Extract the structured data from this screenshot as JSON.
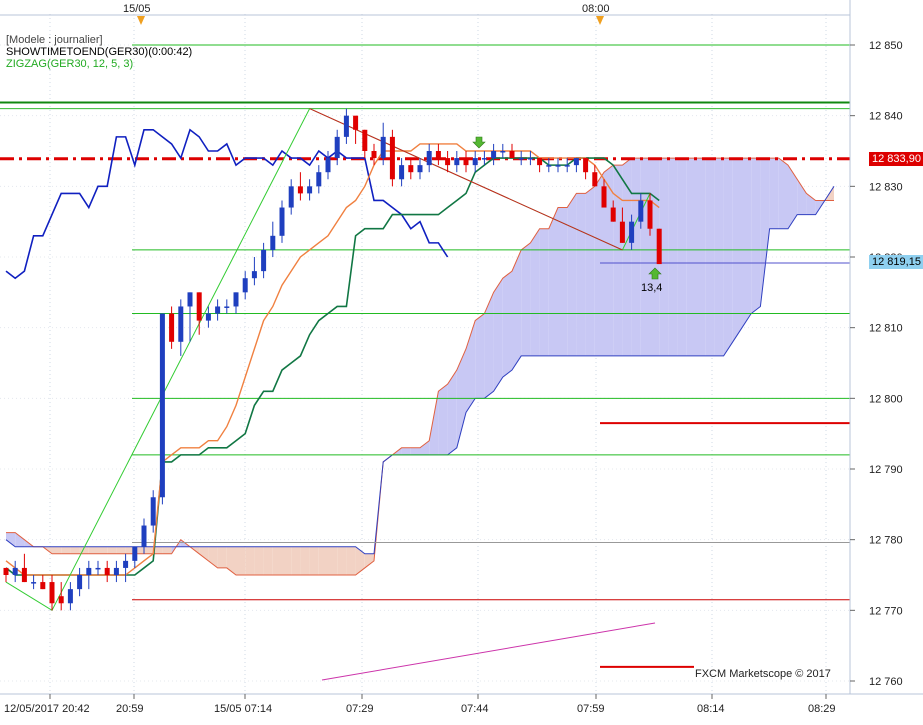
{
  "header": {
    "model_label": "[Modele : journalier]",
    "indicator_1": "SHOWTIMETOEND(GER30)(0:00:42)",
    "indicator_2": "ZIGZAG(GER30, 12, 5, 3)",
    "date_marker_1": "15/05",
    "date_marker_2": "08:00"
  },
  "price_tags": {
    "current": "12 833,90",
    "last": "12 819,15"
  },
  "annotation": "13,4",
  "watermark": "FXCM Marketscope © 2017",
  "colors": {
    "bull": "#1f3fbf",
    "bear": "#e00000",
    "kumo_bull": "#c8c8f4",
    "kumo_bear": "#f2d2c4",
    "grid_green": "#22bb22",
    "dash_red": "#dd0000"
  },
  "chart_data": {
    "type": "candlestick",
    "symbol": "GER30",
    "y_ticks": [
      12850,
      12840,
      12830,
      12820,
      12810,
      12800,
      12790,
      12780,
      12770,
      12760
    ],
    "y_tick_labels": [
      "12 850",
      "12 840",
      "12 830",
      "12 820",
      "12 810",
      "12 800",
      "12 790",
      "12 780",
      "12 770",
      "12 760"
    ],
    "x_tick_labels": [
      "12/05/2017 20:42",
      "20:59",
      "15/05 07:14",
      "07:29",
      "07:44",
      "07:59",
      "08:14",
      "08:29"
    ],
    "ylim": [
      12760,
      12853
    ],
    "candles": [
      [
        12776,
        12776,
        12774,
        12775
      ],
      [
        12775,
        12777,
        12774,
        12776
      ],
      [
        12776,
        12778,
        12774,
        12774
      ],
      [
        12774,
        12775,
        12773,
        12774
      ],
      [
        12774,
        12775,
        12773,
        12773
      ],
      [
        12774,
        12775,
        12770,
        12771
      ],
      [
        12772,
        12774,
        12770,
        12771
      ],
      [
        12771,
        12774,
        12770,
        12773
      ],
      [
        12773,
        12776,
        12772,
        12775
      ],
      [
        12775,
        12777,
        12773,
        12776
      ],
      [
        12776,
        12777,
        12775,
        12776
      ],
      [
        12776,
        12777,
        12774,
        12775
      ],
      [
        12775,
        12777,
        12774,
        12776
      ],
      [
        12776,
        12778,
        12774,
        12777
      ],
      [
        12777,
        12779,
        12776,
        12779
      ],
      [
        12779,
        12783,
        12778,
        12782
      ],
      [
        12782,
        12787,
        12781,
        12786
      ],
      [
        12786,
        12812,
        12785,
        12812
      ],
      [
        12812,
        12813,
        12807,
        12808
      ],
      [
        12808,
        12814,
        12806,
        12813
      ],
      [
        12813,
        12815,
        12808,
        12815
      ],
      [
        12815,
        12815,
        12809,
        12811
      ],
      [
        12811,
        12813,
        12810,
        12812
      ],
      [
        12812,
        12814,
        12811,
        12813
      ],
      [
        12813,
        12814,
        12812,
        12813
      ],
      [
        12813,
        12815,
        12812,
        12815
      ],
      [
        12815,
        12818,
        12814,
        12817
      ],
      [
        12817,
        12820,
        12816,
        12818
      ],
      [
        12818,
        12822,
        12817,
        12821
      ],
      [
        12821,
        12825,
        12820,
        12823
      ],
      [
        12823,
        12828,
        12822,
        12827
      ],
      [
        12827,
        12831,
        12826,
        12830
      ],
      [
        12830,
        12832,
        12828,
        12829
      ],
      [
        12829,
        12831,
        12828,
        12830
      ],
      [
        12830,
        12833,
        12829,
        12832
      ],
      [
        12832,
        12835,
        12831,
        12834
      ],
      [
        12834,
        12838,
        12833,
        12837
      ],
      [
        12837,
        12841,
        12836,
        12840
      ],
      [
        12840,
        12839,
        12836,
        12838
      ],
      [
        12838,
        12838,
        12834,
        12835
      ],
      [
        12835,
        12836,
        12833,
        12834
      ],
      [
        12834,
        12839,
        12833,
        12837
      ],
      [
        12837,
        12838,
        12830,
        12831
      ],
      [
        12831,
        12834,
        12830,
        12833
      ],
      [
        12833,
        12834,
        12831,
        12832
      ],
      [
        12832,
        12834,
        12831,
        12833
      ],
      [
        12833,
        12836,
        12832,
        12835
      ],
      [
        12835,
        12836,
        12833,
        12834
      ],
      [
        12834,
        12835,
        12832,
        12833
      ],
      [
        12833,
        12835,
        12832,
        12834
      ],
      [
        12834,
        12835,
        12832,
        12833
      ],
      [
        12833,
        12835,
        12832,
        12834
      ],
      [
        12834,
        12835,
        12833,
        12834
      ],
      [
        12834,
        12836,
        12833,
        12835
      ],
      [
        12835,
        12836,
        12834,
        12835
      ],
      [
        12835,
        12836,
        12834,
        12834
      ],
      [
        12834,
        12835,
        12833,
        12834
      ],
      [
        12834,
        12835,
        12833,
        12834
      ],
      [
        12834,
        12834,
        12832,
        12833
      ],
      [
        12833,
        12834,
        12832,
        12833
      ],
      [
        12833,
        12834,
        12832,
        12833
      ],
      [
        12833,
        12834,
        12832,
        12833
      ],
      [
        12833,
        12834,
        12832,
        12834
      ],
      [
        12834,
        12834,
        12831,
        12832
      ],
      [
        12832,
        12833,
        12830,
        12830
      ],
      [
        12830,
        12831,
        12827,
        12827
      ],
      [
        12827,
        12828,
        12825,
        12825
      ],
      [
        12825,
        12827,
        12822,
        12822
      ],
      [
        12822,
        12826,
        12821,
        12825
      ],
      [
        12825,
        12829,
        12824,
        12828
      ],
      [
        12828,
        12829,
        12823,
        12824
      ],
      [
        12824,
        12824,
        12819,
        12819
      ]
    ],
    "tenkan": [
      12777,
      12776,
      12775,
      12775,
      12775,
      12775,
      12775,
      12775,
      12775,
      12775,
      12775,
      12775,
      12775,
      12775,
      12776,
      12777,
      12778,
      12791,
      12792,
      12793,
      12793,
      12793,
      12794,
      12794,
      12796,
      12799,
      12803,
      12807,
      12811,
      12813,
      12816,
      12818,
      12820,
      12821,
      12822,
      12823,
      12825,
      12827,
      12828,
      12830,
      12833,
      12835,
      12835,
      12835,
      12835,
      12836,
      12836,
      12836,
      12836,
      12836,
      12835,
      12835,
      12835,
      12835,
      12835,
      12835,
      12835,
      12835,
      12834,
      12834,
      12834,
      12834,
      12834,
      12834,
      12833,
      12831,
      12829,
      12828,
      12828,
      12828,
      12828,
      12827
    ],
    "kijun": [
      12776,
      12775,
      12775,
      12775,
      12775,
      12775,
      12775,
      12775,
      12775,
      12775,
      12775,
      12775,
      12775,
      12775,
      12775,
      12776,
      12777,
      12791,
      12791,
      12792,
      12792,
      12792,
      12793,
      12793,
      12793,
      12794,
      12795,
      12799,
      12801,
      12801,
      12804,
      12805,
      12806,
      12809,
      12811,
      12812,
      12813,
      12813,
      12823,
      12824,
      12824,
      12824,
      12826,
      12826,
      12826,
      12826,
      12826,
      12826,
      12827,
      12828,
      12829,
      12832,
      12833,
      12834,
      12834,
      12834,
      12834,
      12834,
      12834,
      12833,
      12833,
      12833,
      12834,
      12834,
      12834,
      12834,
      12833,
      12831,
      12829,
      12829,
      12829,
      12828
    ],
    "chikou": [
      12818,
      12817,
      12818,
      12823,
      12823,
      12826,
      12829,
      12829,
      12829,
      12827,
      12830,
      12830,
      12837,
      12837,
      12833,
      12838,
      12838,
      12837,
      12836,
      12834,
      12838,
      12837,
      12835,
      12835,
      12836,
      12833,
      12834,
      12834,
      12834,
      12833,
      12835,
      12834,
      12834,
      12833,
      12835,
      12834,
      12835,
      12834,
      12834,
      12834,
      12828,
      12828,
      12827,
      12826,
      12824,
      12825,
      12822,
      12822,
      12820
    ],
    "senkou_a": [
      12781,
      12781,
      12780,
      12779,
      12779,
      12778,
      12778,
      12778,
      12778,
      12778,
      12778,
      12778,
      12778,
      12778,
      12778,
      12778,
      12778,
      12778,
      12778,
      12780,
      12779,
      12778,
      12777,
      12776,
      12776,
      12775,
      12775,
      12775,
      12775,
      12775,
      12775,
      12775,
      12775,
      12775,
      12775,
      12775,
      12775,
      12775,
      12775,
      12776,
      12777,
      12791,
      12792,
      12793,
      12793,
      12793,
      12794,
      12801,
      12802,
      12804,
      12807,
      12811,
      12812,
      12815,
      12817,
      12818,
      12821,
      12822,
      12824,
      12824,
      12827,
      12827,
      12829,
      12829,
      12830,
      12832,
      12833,
      12833,
      12834,
      12834,
      12834,
      12834,
      12834,
      12834,
      12834,
      12834,
      12834,
      12834,
      12834,
      12834,
      12834,
      12834,
      12834,
      12834,
      12834,
      12833,
      12831,
      12829,
      12828,
      12828,
      12828
    ],
    "senkou_b": [
      12780,
      12779,
      12779,
      12779,
      12779,
      12779,
      12779,
      12779,
      12779,
      12779,
      12779,
      12779,
      12779,
      12779,
      12779,
      12779,
      12779,
      12779,
      12779,
      12779,
      12779,
      12779,
      12779,
      12779,
      12779,
      12779,
      12779,
      12779,
      12779,
      12779,
      12779,
      12779,
      12779,
      12779,
      12779,
      12779,
      12779,
      12779,
      12779,
      12778,
      12778,
      12791,
      12792,
      12792,
      12792,
      12792,
      12792,
      12792,
      12792,
      12793,
      12798,
      12800,
      12800,
      12801,
      12803,
      12804,
      12806,
      12806,
      12806,
      12806,
      12806,
      12806,
      12806,
      12806,
      12806,
      12806,
      12806,
      12806,
      12806,
      12806,
      12806,
      12806,
      12806,
      12806,
      12806,
      12806,
      12806,
      12806,
      12806,
      12808,
      12810,
      12812,
      12813,
      12824,
      12824,
      12824,
      12826,
      12826,
      12826,
      12828,
      12830
    ],
    "zigzag": [
      [
        0,
        12774
      ],
      [
        5,
        12770
      ],
      [
        33,
        12841
      ],
      [
        67,
        12821
      ],
      [
        70,
        12829
      ]
    ],
    "h_levels_dark_green": [
      12842,
      12841
    ],
    "h_levels_green": [
      12850,
      12821,
      12812,
      12800,
      12792
    ],
    "h_level_dashdot_red": 12833.9,
    "h_level_blue": 12819.15,
    "h_level_red_full": 12771.5,
    "h_level_red_short": [
      12796.5,
      12762
    ],
    "h_level_grey": 12779.6
  }
}
